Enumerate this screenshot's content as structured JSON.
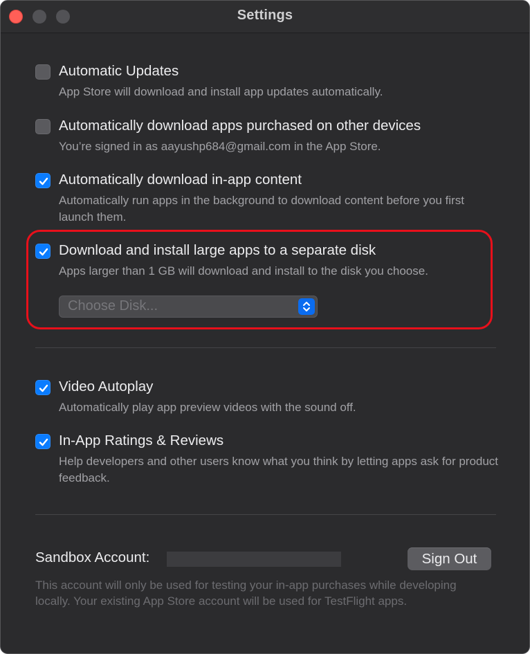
{
  "window": {
    "title": "Settings"
  },
  "options": [
    {
      "label": "Automatic Updates",
      "description": "App Store will download and install app updates automatically.",
      "checked": false
    },
    {
      "label": "Automatically download apps purchased on other devices",
      "description": "You’re signed in as aayushp684@gmail.com in the App Store.",
      "checked": false
    },
    {
      "label": "Automatically download in-app content",
      "description": "Automatically run apps in the background to download content before you first launch them.",
      "checked": true
    },
    {
      "label": "Download and install large apps to a separate disk",
      "description": "Apps larger than 1 GB will download and install to the disk you choose.",
      "checked": true
    },
    {
      "label": "Video Autoplay",
      "description": "Automatically play app preview videos with the sound off.",
      "checked": true
    },
    {
      "label": "In-App Ratings & Reviews",
      "description": "Help developers and other users know what you think by letting apps ask for product feedback.",
      "checked": true
    }
  ],
  "disk_popup": {
    "placeholder": "Choose Disk..."
  },
  "sandbox": {
    "label": "Sandbox Account:",
    "sign_out_label": "Sign Out",
    "footnote": "This account will only be used for testing your in-app purchases while developing locally. Your existing App Store account will be used for TestFlight apps."
  },
  "colors": {
    "accent": "#0a7cff",
    "highlight": "#e8101b",
    "background": "#2b2b2d"
  }
}
